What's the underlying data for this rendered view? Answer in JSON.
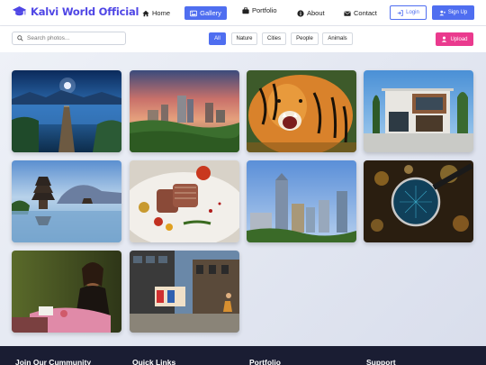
{
  "brand": {
    "name": "Kalvi World Official",
    "icon": "graduation-cap-icon"
  },
  "nav": {
    "items": [
      {
        "label": "Home",
        "icon": "home-icon"
      },
      {
        "label": "Gallery",
        "icon": "image-icon",
        "active": true
      },
      {
        "label": "Portfolio",
        "icon": "briefcase-icon"
      },
      {
        "label": "About",
        "icon": "info-icon"
      },
      {
        "label": "Contact",
        "icon": "envelope-icon"
      }
    ],
    "login_label": "Login",
    "signup_label": "Sign Up"
  },
  "toolbar": {
    "search_placeholder": "Search photos...",
    "filters": [
      "All",
      "Nature",
      "Cities",
      "People",
      "Animals"
    ],
    "active_filter": "All",
    "upload_label": "Upload"
  },
  "gallery": {
    "photos": [
      {
        "subject": "moonlit lake pier"
      },
      {
        "subject": "city skyline at sunset"
      },
      {
        "subject": "roaring tiger"
      },
      {
        "subject": "modern house"
      },
      {
        "subject": "temple on lake"
      },
      {
        "subject": "gourmet dish"
      },
      {
        "subject": "downtown skyscrapers"
      },
      {
        "subject": "magnifying glass with bokeh"
      },
      {
        "subject": "girl reading"
      },
      {
        "subject": "city street with cyclist"
      }
    ]
  },
  "footer": {
    "columns": [
      "Join Our Cummunity",
      "Quick Links",
      "Portfolio",
      "Support"
    ]
  },
  "colors": {
    "primary": "#4f6ef0",
    "brand": "#4f46e5",
    "upload": "#ea3a8e",
    "footer": "#1a1d33"
  }
}
